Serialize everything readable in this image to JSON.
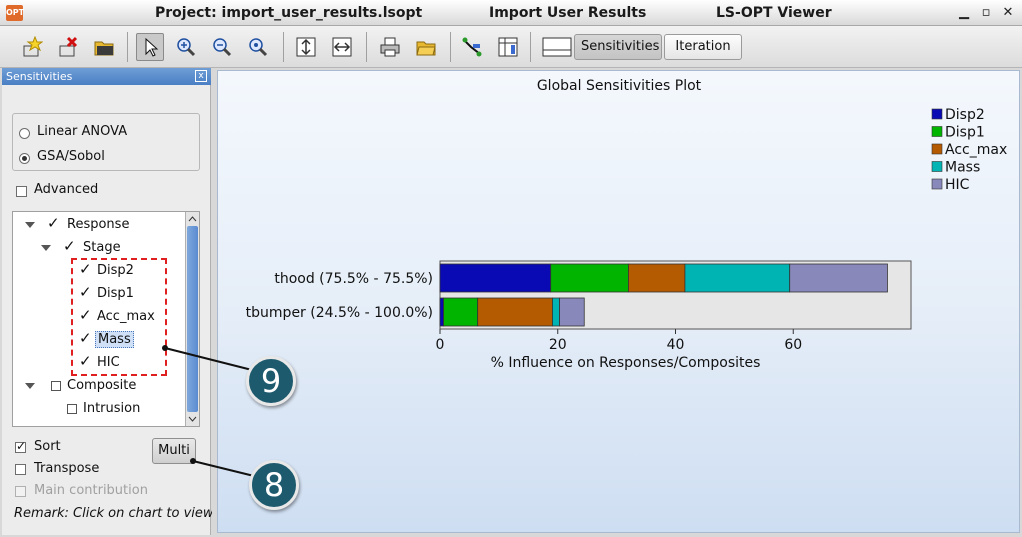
{
  "window": {
    "title_project": "Project: import_user_results.lsopt",
    "title_section": "Import User Results",
    "title_app": "LS-OPT Viewer",
    "app_icon_text": "OPT",
    "ctrl_minimize": "▁",
    "ctrl_maximize": "▫",
    "ctrl_close": "✕"
  },
  "toolbar": {
    "sensitivities_label": "Sensitivities",
    "iteration_label": "Iteration",
    "icons": [
      "new-plot-icon",
      "delete-plot-icon",
      "open-folder-icon",
      "pointer-icon",
      "zoom-in-icon",
      "zoom-out-icon",
      "zoom-fit-icon",
      "fit-vertical-icon",
      "fit-horizontal-icon",
      "print-icon",
      "folder-icon",
      "curve-tool-icon",
      "table-tool-icon",
      "layout-icon"
    ]
  },
  "panel": {
    "title": "Sensitivities",
    "close_glyph": "x",
    "method_options": [
      "Linear ANOVA",
      "GSA/Sobol"
    ],
    "selected_method": "GSA/Sobol",
    "advanced_label": "Advanced",
    "tree": {
      "response": "Response",
      "stage": "Stage",
      "items": [
        "Disp2",
        "Disp1",
        "Acc_max",
        "Mass",
        "HIC"
      ],
      "selected_item": "Mass",
      "composite": "Composite",
      "intrusion": "Intrusion"
    },
    "sort_label": "Sort",
    "transpose_label": "Transpose",
    "main_contribution_label": "Main contribution",
    "multi_label": "Multi",
    "remark": "Remark: Click on chart to view"
  },
  "callouts": [
    "9",
    "8"
  ],
  "chart_data": {
    "type": "bar",
    "orientation": "horizontal",
    "stacked": true,
    "title": "Global Sensitivities Plot",
    "xlabel": "% Influence on Responses/Composites",
    "categories": [
      "thood (75.5% - 75.5%)",
      "tbumper (24.5% - 100.0%)"
    ],
    "x_ticks": [
      0,
      20,
      40,
      60
    ],
    "xlim": [
      0,
      80
    ],
    "legend_position": "top-right",
    "series": [
      {
        "name": "Disp2",
        "color": "#0a0ab4",
        "values": [
          18.8,
          0.6
        ]
      },
      {
        "name": "Disp1",
        "color": "#00b400",
        "values": [
          13.2,
          5.8
        ]
      },
      {
        "name": "Acc_max",
        "color": "#b45a00",
        "values": [
          9.6,
          12.7
        ]
      },
      {
        "name": "Mass",
        "color": "#00b4b4",
        "values": [
          17.8,
          1.2
        ]
      },
      {
        "name": "HIC",
        "color": "#8888bb",
        "values": [
          16.6,
          4.2
        ]
      }
    ]
  }
}
